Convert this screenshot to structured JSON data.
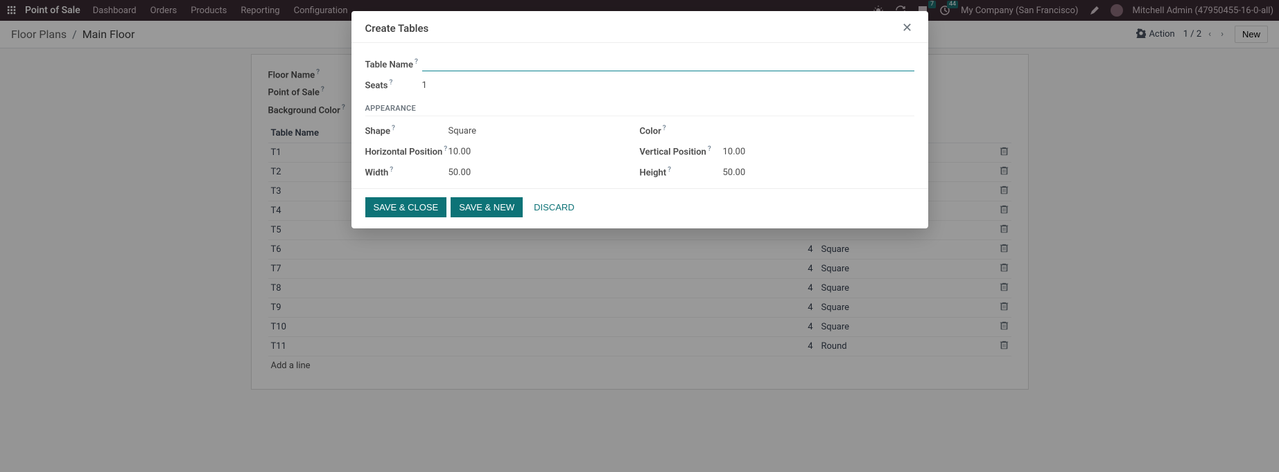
{
  "topnav": {
    "brand": "Point of Sale",
    "links": [
      "Dashboard",
      "Orders",
      "Products",
      "Reporting",
      "Configuration"
    ],
    "chat_badge": "7",
    "activity_badge": "44",
    "company": "My Company (San Francisco)",
    "user": "Mitchell Admin (47950455-16-0-all)"
  },
  "breadcrumb": {
    "parent": "Floor Plans",
    "current": "Main Floor"
  },
  "cp": {
    "action": "Action",
    "pager": "1 / 2",
    "new": "New"
  },
  "form": {
    "label_floor_name": "Floor Name",
    "label_pos": "Point of Sale",
    "label_bg": "Background Color"
  },
  "list": {
    "header_name": "Table Name",
    "add_line": "Add a line",
    "rows": [
      {
        "name": "T1",
        "seats": "",
        "shape": ""
      },
      {
        "name": "T2",
        "seats": "",
        "shape": ""
      },
      {
        "name": "T3",
        "seats": "",
        "shape": ""
      },
      {
        "name": "T4",
        "seats": "",
        "shape": ""
      },
      {
        "name": "T5",
        "seats": "",
        "shape": ""
      },
      {
        "name": "T6",
        "seats": "4",
        "shape": "Square"
      },
      {
        "name": "T7",
        "seats": "4",
        "shape": "Square"
      },
      {
        "name": "T8",
        "seats": "4",
        "shape": "Square"
      },
      {
        "name": "T9",
        "seats": "4",
        "shape": "Square"
      },
      {
        "name": "T10",
        "seats": "4",
        "shape": "Square"
      },
      {
        "name": "T11",
        "seats": "4",
        "shape": "Round"
      }
    ]
  },
  "modal": {
    "title": "Create Tables",
    "label_table_name": "Table Name",
    "label_seats": "Seats",
    "val_seats": "1",
    "section_appearance": "APPEARANCE",
    "label_shape": "Shape",
    "val_shape": "Square",
    "label_color": "Color",
    "label_hpos": "Horizontal Position",
    "val_hpos": "10.00",
    "label_vpos": "Vertical Position",
    "val_vpos": "10.00",
    "label_width": "Width",
    "val_width": "50.00",
    "label_height": "Height",
    "val_height": "50.00",
    "btn_save_close": "SAVE & CLOSE",
    "btn_save_new": "SAVE & NEW",
    "btn_discard": "DISCARD"
  }
}
